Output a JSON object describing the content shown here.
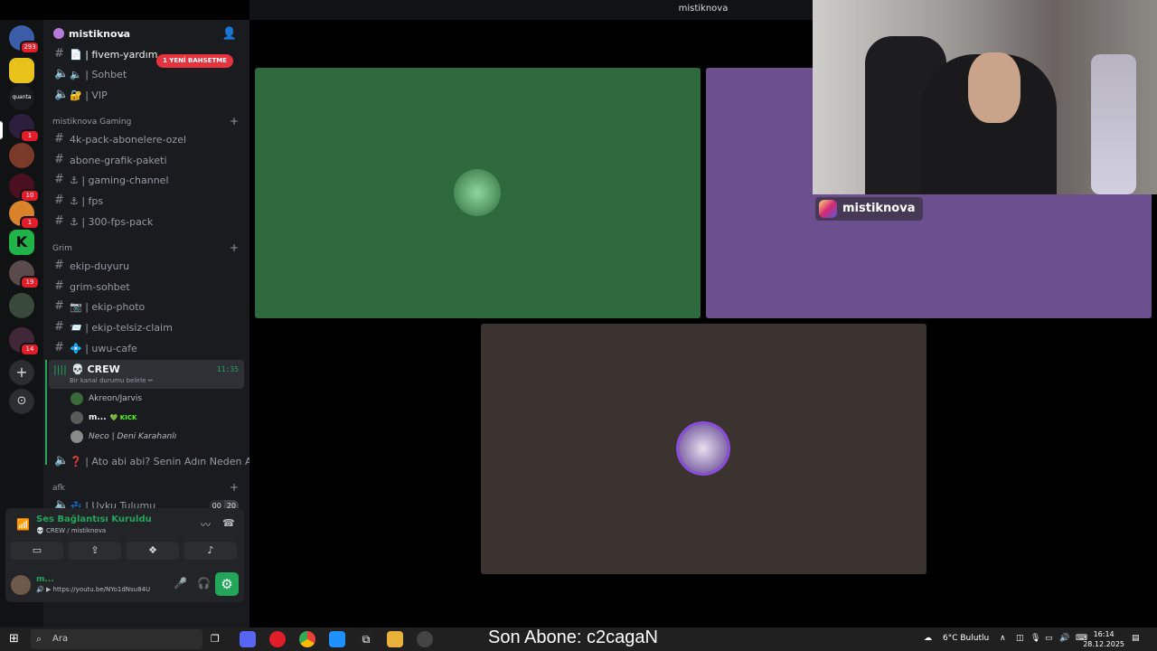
{
  "window": {
    "title": "mistiknova"
  },
  "rail": {
    "badges": [
      "293",
      "1",
      "10",
      "1",
      "19",
      "14"
    ]
  },
  "server": {
    "name": "mistiknova"
  },
  "mention_pill": "1 YENİ BAHSETME",
  "top_channels": [
    {
      "label": "📄 | fivem-yardım"
    },
    {
      "label": "🔈 | Sohbet"
    },
    {
      "label": "🔐 | VIP"
    }
  ],
  "categories": {
    "gaming": "mistiknova Gaming",
    "grim": "Grim",
    "afk": "afk"
  },
  "gaming_channels": [
    "4k-pack-abonelere-ozel",
    "abone-grafik-paketi",
    "⚓ | gaming-channel",
    "⚓ | fps",
    "⚓ | 300-fps-pack"
  ],
  "grim_channels": [
    "ekip-duyuru",
    "grim-sohbet",
    "📷 | ekip-photo",
    "📨 | ekip-telsiz-claim",
    "💠 | uwu-cafe"
  ],
  "crew": {
    "label": "💀 CREW",
    "status": "Bir kanal durumu belirle ✏",
    "time": "11:35",
    "members": [
      {
        "name": "Akreon/Jarvis"
      },
      {
        "name": "m...",
        "tag": "💚 KICK"
      },
      {
        "name": "Neco | Deni Karahanlı"
      }
    ]
  },
  "ato_channel": "❓ | Ato abi abi? Senin Adın Neden Ato...",
  "uyku": {
    "label": "💤 | Uyku Tulumu",
    "c1": "00",
    "c2": "20"
  },
  "voice_panel": {
    "status": "Ses Bağlantısı Kuruldu",
    "channel": "💀 CREW / mistiknova"
  },
  "user_bar": {
    "name": "m...",
    "activity": "🔊 ▶ https://youtu.be/NYo1dNsu84U"
  },
  "stream_overlay": {
    "instagram": "mistiknova",
    "last_sub": "Son Abone: c2cagaN"
  },
  "taskbar": {
    "search_placeholder": "Ara",
    "weather": "6°C  Bulutlu",
    "time": "16:14",
    "date": "28.12.2025"
  },
  "colors": {
    "green_tile": "#2e6a3d",
    "purple_tile": "#6c4f8f",
    "brown_tile": "#3a3330",
    "accent_green": "#23a55a"
  }
}
